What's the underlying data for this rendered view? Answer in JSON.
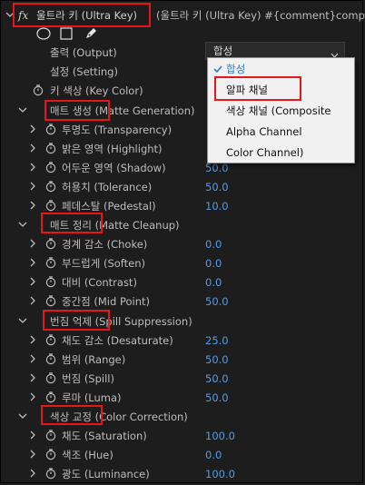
{
  "header": {
    "fx": "fx",
    "effect_name": "울트라 키 (Ultra Key)",
    "path": "(울트라 키 (Ultra Key)  #{comment}comp..."
  },
  "tools": [
    "ellipse-mask-tool",
    "rectangle-mask-tool",
    "pen-mask-tool"
  ],
  "output": {
    "label": "출력 (Output)",
    "value": "합성"
  },
  "setting": {
    "label": "설정 (Setting)"
  },
  "key_color": {
    "label": "키 색상 (Key Color)"
  },
  "dropdown": {
    "items": [
      {
        "label": "합성",
        "selected": true
      },
      {
        "label": "알파 채널",
        "selected": false
      },
      {
        "label": "색상 채널 (Composite",
        "selected": false
      },
      {
        "label": "Alpha Channel",
        "selected": false
      },
      {
        "label": "Color Channel)",
        "selected": false
      }
    ]
  },
  "groups": {
    "matte_generation": {
      "label": "매트 생성 (Matte Generation)",
      "props": [
        {
          "label": "투명도 (Transparency)",
          "value": ""
        },
        {
          "label": "밝은 영역 (Highlight)",
          "value": ""
        },
        {
          "label": "어두운 영역 (Shadow)",
          "value": "50.0"
        },
        {
          "label": "허용치 (Tolerance)",
          "value": "50.0"
        },
        {
          "label": "페데스탈 (Pedestal)",
          "value": "10.0"
        }
      ]
    },
    "matte_cleanup": {
      "label": "매트 정리 (Matte Cleanup)",
      "props": [
        {
          "label": "경계 감소 (Choke)",
          "value": "0.0"
        },
        {
          "label": "부드럽게 (Soften)",
          "value": "0.0"
        },
        {
          "label": "대비 (Contrast)",
          "value": "0.0"
        },
        {
          "label": "중간점 (Mid Point)",
          "value": "50.0"
        }
      ]
    },
    "spill_suppression": {
      "label": "번짐 억제 (Spill Suppression)",
      "props": [
        {
          "label": "채도 감소 (Desaturate)",
          "value": "25.0"
        },
        {
          "label": "범위 (Range)",
          "value": "50.0"
        },
        {
          "label": "번짐 (Spill)",
          "value": "50.0"
        },
        {
          "label": "루마 (Luma)",
          "value": "50.0"
        }
      ]
    },
    "color_correction": {
      "label": "색상 교정 (Color Correction)",
      "props": [
        {
          "label": "채도 (Saturation)",
          "value": "100.0"
        },
        {
          "label": "색조 (Hue)",
          "value": "0.0"
        },
        {
          "label": "광도 (Luminance)",
          "value": "100.0"
        }
      ]
    }
  },
  "colors": {
    "value_blue": "#4f9de8",
    "highlight_red": "#e8161a",
    "menu_selected": "#2a78d6"
  }
}
